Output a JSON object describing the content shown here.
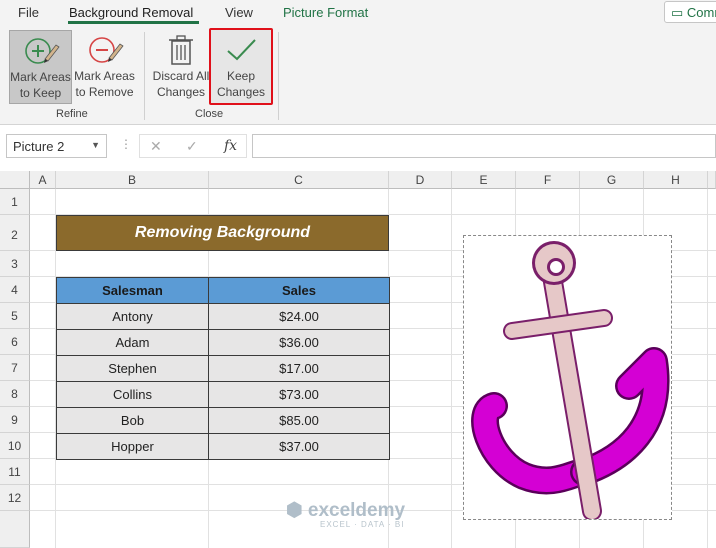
{
  "menu": {
    "tabs": [
      "File",
      "Background Removal",
      "View",
      "Picture Format"
    ],
    "comments_label": "Comments"
  },
  "ribbon": {
    "mark_keep": [
      "Mark Areas",
      "to Keep"
    ],
    "mark_remove": [
      "Mark Areas",
      "to Remove"
    ],
    "discard": [
      "Discard All",
      "Changes"
    ],
    "keep": [
      "Keep",
      "Changes"
    ],
    "group_refine": "Refine",
    "group_close": "Close"
  },
  "formula_bar": {
    "name_box": "Picture 2",
    "fx": "fx",
    "value": ""
  },
  "sheet": {
    "columns": [
      "A",
      "B",
      "C",
      "D",
      "E",
      "F",
      "G",
      "H"
    ],
    "rows": [
      "1",
      "2",
      "3",
      "4",
      "5",
      "6",
      "7",
      "8",
      "9",
      "10",
      "11",
      "12"
    ],
    "title": "Removing Background",
    "table": {
      "headers": [
        "Salesman",
        "Sales"
      ],
      "rows": [
        [
          "Antony",
          "$24.00"
        ],
        [
          "Adam",
          "$36.00"
        ],
        [
          "Stephen",
          "$17.00"
        ],
        [
          "Collins",
          "$73.00"
        ],
        [
          "Bob",
          "$85.00"
        ],
        [
          "Hopper",
          "$37.00"
        ]
      ]
    }
  },
  "watermark": {
    "name": "exceldemy",
    "tagline": "EXCEL · DATA · BI"
  },
  "colors": {
    "accent": "#217346",
    "title_fill": "#8b6a2c",
    "header_fill": "#5b9bd5",
    "highlight": "#e0101a",
    "anchor_shaft": "#e6c8c8",
    "anchor_arms": "#d400d4"
  },
  "icons": [
    "mark-keep-icon",
    "mark-remove-icon",
    "trash-icon",
    "checkmark-icon",
    "anchor-image"
  ]
}
